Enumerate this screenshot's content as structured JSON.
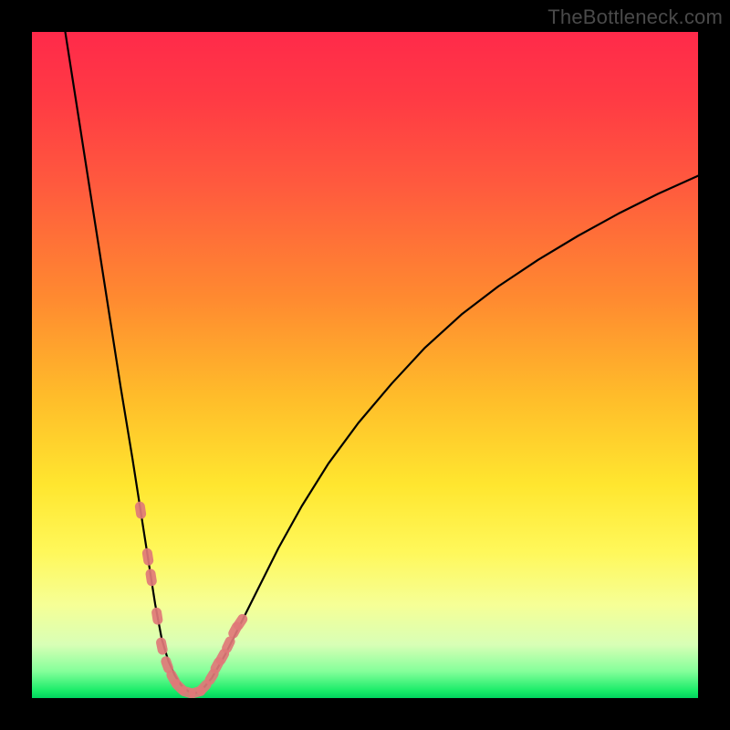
{
  "watermark": "TheBottleneck.com",
  "chart_data": {
    "type": "line",
    "title": "",
    "xlabel": "",
    "ylabel": "",
    "xlim": [
      0,
      100
    ],
    "ylim": [
      0,
      100
    ],
    "grid": false,
    "legend": false,
    "series": [
      {
        "name": "bottleneck-curve",
        "color": "#000000",
        "x": [
          5.0,
          6.5,
          8.2,
          9.9,
          11.6,
          13.3,
          15.1,
          16.8,
          18.5,
          19.5,
          20.5,
          21.5,
          22.5,
          23.5,
          24.5,
          25.5,
          27.0,
          29.0,
          31.5,
          34.0,
          37.0,
          40.5,
          44.5,
          49.0,
          54.0,
          59.0,
          64.5,
          70.0,
          76.0,
          82.0,
          88.0,
          94.0,
          100.0
        ],
        "y": [
          100.0,
          90.4,
          79.5,
          68.6,
          57.7,
          46.8,
          35.9,
          25.0,
          14.1,
          8.8,
          5.5,
          3.3,
          1.8,
          1.0,
          0.7,
          1.2,
          3.0,
          6.5,
          11.5,
          16.5,
          22.5,
          28.8,
          35.2,
          41.3,
          47.2,
          52.6,
          57.6,
          61.8,
          65.8,
          69.4,
          72.7,
          75.7,
          78.4
        ]
      }
    ],
    "markers": {
      "name": "data-points",
      "color": "#e07878",
      "shape": "rounded-rect",
      "x": [
        16.3,
        17.4,
        17.9,
        18.8,
        19.5,
        20.3,
        21.2,
        22.1,
        23.3,
        24.8,
        25.8,
        27.0,
        27.8,
        28.6,
        29.5,
        30.5,
        31.3
      ],
      "y": [
        28.2,
        21.2,
        18.1,
        12.3,
        7.8,
        5.0,
        3.0,
        1.7,
        0.9,
        0.9,
        1.6,
        3.2,
        4.9,
        6.2,
        8.0,
        10.2,
        11.4
      ]
    }
  }
}
